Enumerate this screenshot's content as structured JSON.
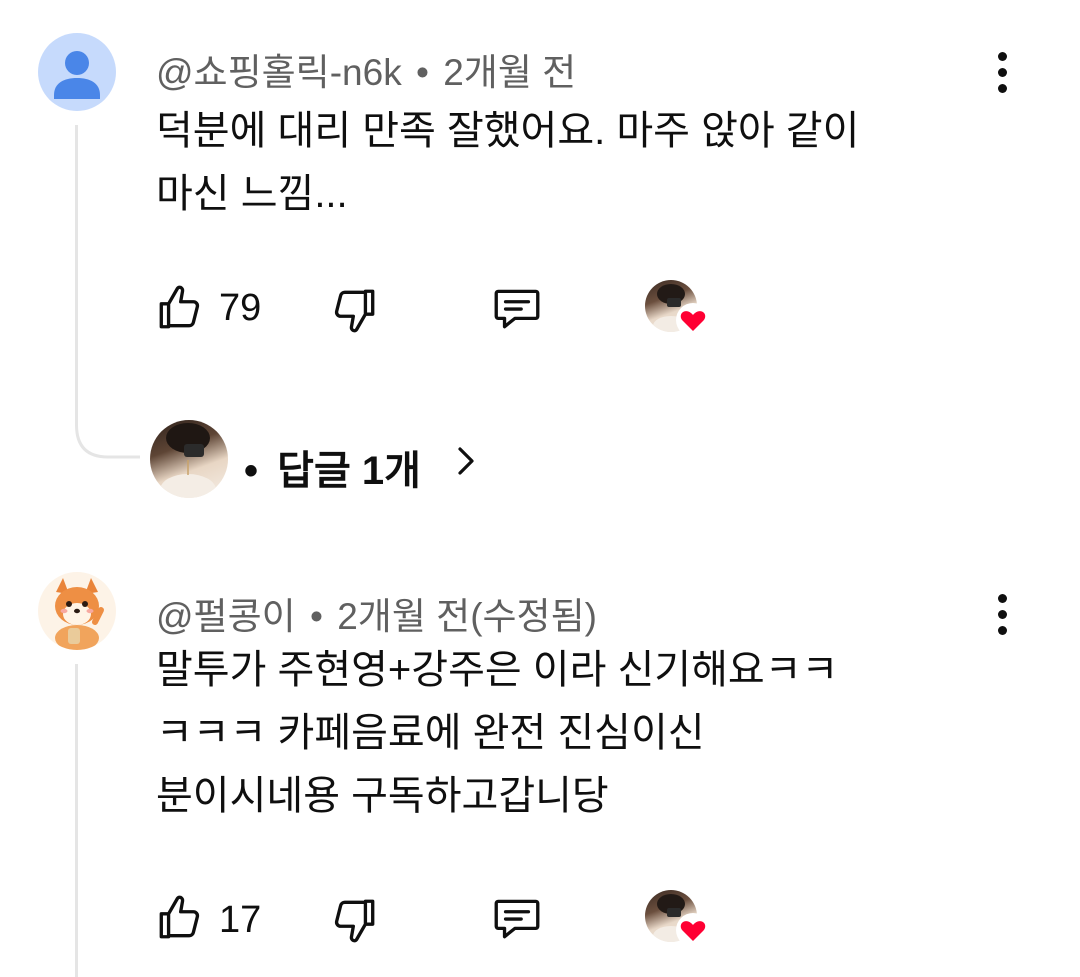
{
  "comments": [
    {
      "author": "@쇼핑홀릭-n6k",
      "separator": "•",
      "time": "2개월 전",
      "text_lines": [
        "덕분에 대리 만족 잘했어요. 마주 앉아 같이",
        "마신 느낌..."
      ],
      "likes": "79",
      "avatar_icon": "default-person-icon",
      "creator_heart": true,
      "replies": {
        "label": "답글 1개",
        "bullet": "•"
      }
    },
    {
      "author": "@펄콩이",
      "separator": "•",
      "time": "2개월 전(수정됨)",
      "text_lines": [
        "말투가 주현영+강주은 이라 신기해요ㅋㅋ",
        "ㅋㅋㅋ 카페음료에 완전 진심이신",
        "분이시네용 구독하고갑니당"
      ],
      "likes": "17",
      "avatar_icon": "shiba-dog-avatar",
      "creator_heart": true
    }
  ],
  "colors": {
    "heart": "#ff0033",
    "meta": "#606060",
    "avatar_default_bg": "#c6dafc",
    "avatar_default_fg": "#4a86e8"
  }
}
